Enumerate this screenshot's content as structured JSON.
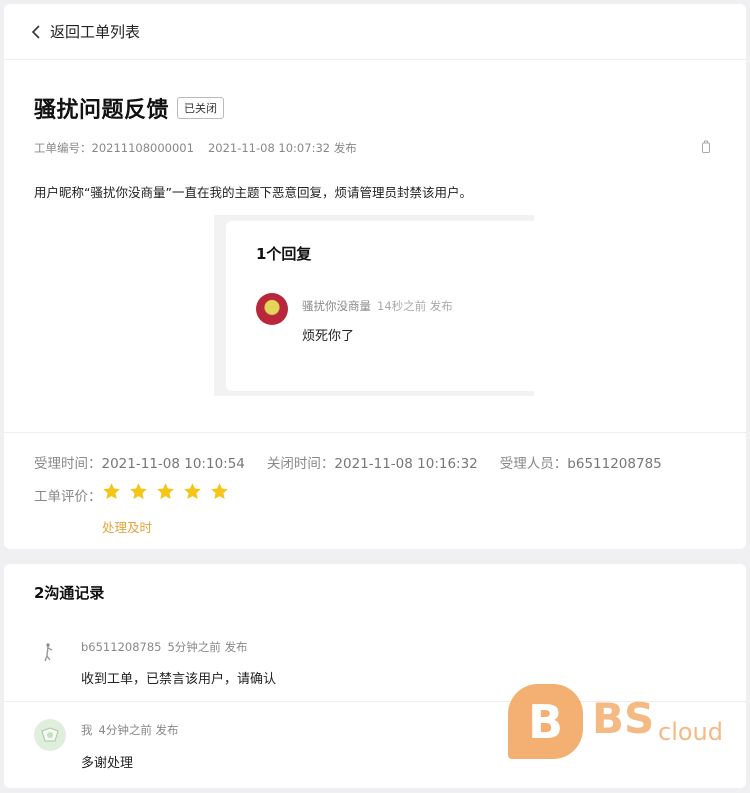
{
  "nav": {
    "back_label": "返回工单列表"
  },
  "ticket": {
    "title": "骚扰问题反馈",
    "status": "已关闭",
    "number_label": "工单编号：",
    "number": "20211108000001",
    "published": "2021-11-08 10:07:32 发布",
    "description": "用户昵称“骚扰你没商量”一直在我的主题下恶意回复，烦请管理员封禁该用户。"
  },
  "quoted_post": {
    "reply_count": "1个回复",
    "reply": {
      "user": "骚扰你没商量",
      "time": "14秒之前 发布",
      "text": "烦死你了"
    }
  },
  "processing": {
    "accept_label": "受理时间：",
    "accept_time": "2021-11-08 10:10:54",
    "close_label": "关闭时间：",
    "close_time": "2021-11-08 10:16:32",
    "handler_label": "受理人员：",
    "handler": "b6511208785",
    "rating_label": "工单评价：",
    "rating": 5,
    "rating_max": 5,
    "rating_text": "处理及时"
  },
  "communication": {
    "title": "2沟通记录",
    "records": [
      {
        "user": "b6511208785",
        "time": "5分钟之前 发布",
        "text": "收到工单，已禁言该用户，请确认"
      },
      {
        "user": "我",
        "time": "4分钟之前 发布",
        "text": "多谢处理"
      }
    ]
  },
  "colors": {
    "star": "#f5c518",
    "rating_text": "#e8a43a",
    "status_border": "#bbbbbb"
  },
  "watermark": {
    "letter": "B",
    "brand": "BS",
    "suffix": "cloud"
  }
}
